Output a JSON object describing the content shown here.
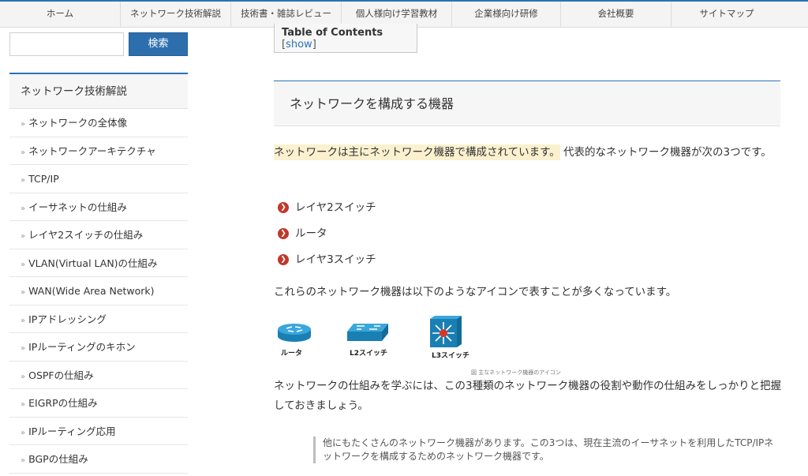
{
  "nav": {
    "items": [
      "ホーム",
      "ネットワーク技術解説",
      "技術書・雑誌レビュー",
      "個人様向け学習教材",
      "企業様向け研修",
      "会社概要",
      "サイトマップ"
    ]
  },
  "search": {
    "button_label": "検索",
    "value": ""
  },
  "sidebar": {
    "title": "ネットワーク技術解説",
    "items": [
      "ネットワークの全体像",
      "ネットワークアーキテクチャ",
      "TCP/IP",
      "イーサネットの仕組み",
      "レイヤ2スイッチの仕組み",
      "VLAN(Virtual LAN)の仕組み",
      "WAN(Wide Area Network)",
      "IPアドレッシング",
      "IPルーティングのキホン",
      "OSPFの仕組み",
      "EIGRPの仕組み",
      "IPルーティング応用",
      "BGPの仕組み"
    ],
    "bullet": "»"
  },
  "toc": {
    "title": "Table of Contents",
    "open_bracket": " [",
    "toggle_label": "show",
    "close_bracket": "]"
  },
  "main": {
    "heading": "ネットワークを構成する機器",
    "para1_highlight": "ネットワークは主にネットワーク機器で構成されています。",
    "para1_rest": "代表的なネットワーク機器が次の3つです。",
    "list": [
      "レイヤ2スイッチ",
      "ルータ",
      "レイヤ3スイッチ"
    ],
    "para2": "これらのネットワーク機器は以下のようなアイコンで表すことが多くなっています。",
    "figure": {
      "labels": [
        "ルータ",
        "L2スイッチ",
        "L3スイッチ"
      ],
      "caption": "図 主なネットワーク機器のアイコン"
    },
    "para3": "ネットワークの仕組みを学ぶには、この3種類のネットワーク機器の役割や動作の仕組みをしっかりと把握しておきましょう。",
    "note": "他にもたくさんのネットワーク機器があります。この3つは、現在主流のイーサネットを利用したTCP/IPネットワークを構成するためのネットワーク機器です。"
  },
  "colors": {
    "accent": "#2a73b8",
    "button": "#2d6fad",
    "highlight": "#fbf1cf",
    "chevron": "#c0392b",
    "icon_blue": "#1f8fc4"
  }
}
